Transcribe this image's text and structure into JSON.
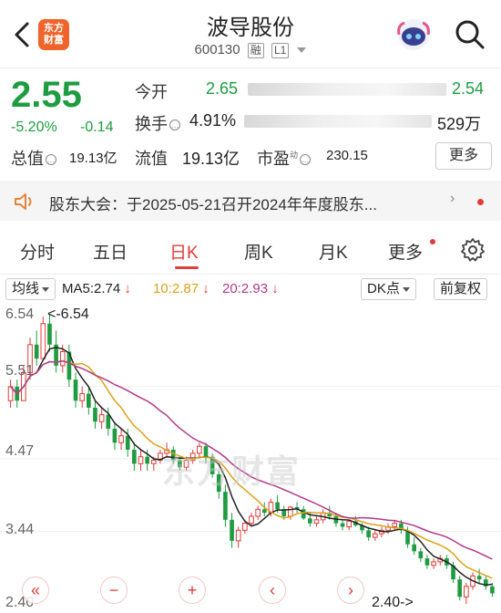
{
  "header": {
    "logo_line1": "东方",
    "logo_line2": "财富",
    "stock_name": "波导股份",
    "stock_code": "600130",
    "tag_rong": "融",
    "tag_level": "L1"
  },
  "quote": {
    "price": "2.55",
    "change_pct": "-5.20%",
    "change_abs": "-0.14",
    "open_label": "今开",
    "open_value": "2.65",
    "open_right": "2.54",
    "turnover_label": "换手",
    "turnover_value": "4.91%",
    "volume_value": "529万",
    "total_cap_label": "总值",
    "total_cap_value": "19.13亿",
    "float_cap_label": "流值",
    "float_cap_value": "19.13亿",
    "pe_label": "市盈",
    "pe_sup": "动",
    "pe_value": "230.15",
    "more_label": "更多"
  },
  "notice": {
    "text": "股东大会：于2025-05-21召开2024年年度股东...",
    "arrow": "›"
  },
  "tabs": {
    "items": [
      "分时",
      "五日",
      "日K",
      "周K",
      "月K",
      "更多"
    ],
    "active": "日K"
  },
  "ma": {
    "selector": "均线",
    "ma5": "MA5:2.74",
    "ma10": "10:2.87",
    "ma20": "20:2.93",
    "dk_label": "DK点",
    "adjust_label": "前复权",
    "colors": {
      "ma5": "#222222",
      "ma10": "#d8a21c",
      "ma20": "#b23a8a"
    }
  },
  "chart_data": {
    "type": "candlestick",
    "y_ticks": [
      "6.54",
      "5.51",
      "4.47",
      "3.44",
      "2.40"
    ],
    "ylim": [
      2.4,
      6.54
    ],
    "high_annotation": "<-6.54",
    "low_annotation": "2.40->",
    "watermark": "东方财富",
    "colors": {
      "up": "#e23b3b",
      "down": "#1f9c42"
    },
    "candles": [
      [
        5.3,
        5.6,
        5.2,
        5.5
      ],
      [
        5.5,
        5.6,
        5.2,
        5.3
      ],
      [
        5.3,
        5.8,
        5.3,
        5.7
      ],
      [
        5.7,
        6.2,
        5.6,
        6.1
      ],
      [
        6.1,
        6.3,
        5.8,
        5.9
      ],
      [
        5.9,
        6.5,
        5.9,
        6.4
      ],
      [
        6.4,
        6.54,
        6.0,
        6.1
      ],
      [
        6.1,
        6.3,
        5.7,
        5.8
      ],
      [
        5.8,
        6.1,
        5.7,
        6.0
      ],
      [
        6.0,
        6.1,
        5.5,
        5.6
      ],
      [
        5.6,
        5.7,
        5.2,
        5.3
      ],
      [
        5.3,
        5.5,
        5.2,
        5.4
      ],
      [
        5.4,
        5.5,
        5.1,
        5.2
      ],
      [
        5.2,
        5.3,
        4.9,
        5.0
      ],
      [
        5.0,
        5.2,
        4.9,
        5.1
      ],
      [
        5.1,
        5.2,
        4.8,
        4.9
      ],
      [
        4.9,
        5.0,
        4.6,
        4.7
      ],
      [
        4.7,
        4.9,
        4.6,
        4.8
      ],
      [
        4.8,
        4.9,
        4.5,
        4.6
      ],
      [
        4.6,
        4.7,
        4.3,
        4.4
      ],
      [
        4.4,
        4.6,
        4.3,
        4.5
      ],
      [
        4.5,
        4.6,
        4.3,
        4.4
      ],
      [
        4.4,
        4.5,
        4.3,
        4.45
      ],
      [
        4.45,
        4.6,
        4.4,
        4.55
      ],
      [
        4.55,
        4.7,
        4.5,
        4.6
      ],
      [
        4.6,
        4.65,
        4.4,
        4.45
      ],
      [
        4.45,
        4.5,
        4.3,
        4.35
      ],
      [
        4.35,
        4.5,
        4.3,
        4.45
      ],
      [
        4.45,
        4.6,
        4.4,
        4.55
      ],
      [
        4.55,
        4.7,
        4.5,
        4.65
      ],
      [
        4.65,
        4.7,
        4.4,
        4.5
      ],
      [
        4.5,
        4.55,
        4.2,
        4.25
      ],
      [
        4.25,
        4.3,
        3.9,
        4.0
      ],
      [
        4.0,
        4.1,
        3.5,
        3.6
      ],
      [
        3.6,
        3.7,
        3.2,
        3.3
      ],
      [
        3.3,
        3.5,
        3.2,
        3.45
      ],
      [
        3.45,
        3.6,
        3.4,
        3.55
      ],
      [
        3.55,
        3.7,
        3.5,
        3.65
      ],
      [
        3.65,
        3.8,
        3.6,
        3.75
      ],
      [
        3.75,
        3.85,
        3.65,
        3.7
      ],
      [
        3.7,
        3.9,
        3.65,
        3.85
      ],
      [
        3.85,
        3.95,
        3.7,
        3.75
      ],
      [
        3.75,
        3.8,
        3.6,
        3.65
      ],
      [
        3.65,
        3.8,
        3.6,
        3.78
      ],
      [
        3.78,
        3.85,
        3.7,
        3.75
      ],
      [
        3.75,
        3.8,
        3.6,
        3.62
      ],
      [
        3.62,
        3.7,
        3.5,
        3.55
      ],
      [
        3.55,
        3.65,
        3.5,
        3.6
      ],
      [
        3.6,
        3.75,
        3.55,
        3.7
      ],
      [
        3.7,
        3.8,
        3.6,
        3.65
      ],
      [
        3.65,
        3.7,
        3.5,
        3.55
      ],
      [
        3.55,
        3.6,
        3.45,
        3.5
      ],
      [
        3.5,
        3.6,
        3.45,
        3.58
      ],
      [
        3.58,
        3.65,
        3.5,
        3.52
      ],
      [
        3.52,
        3.55,
        3.4,
        3.45
      ],
      [
        3.45,
        3.5,
        3.3,
        3.35
      ],
      [
        3.35,
        3.45,
        3.3,
        3.4
      ],
      [
        3.4,
        3.5,
        3.35,
        3.45
      ],
      [
        3.45,
        3.55,
        3.4,
        3.5
      ],
      [
        3.5,
        3.6,
        3.45,
        3.55
      ],
      [
        3.55,
        3.6,
        3.4,
        3.45
      ],
      [
        3.45,
        3.5,
        3.2,
        3.25
      ],
      [
        3.25,
        3.35,
        3.1,
        3.15
      ],
      [
        3.15,
        3.2,
        3.0,
        3.05
      ],
      [
        3.05,
        3.1,
        2.9,
        2.95
      ],
      [
        2.95,
        3.05,
        2.9,
        3.0
      ],
      [
        3.0,
        3.1,
        2.95,
        3.05
      ],
      [
        3.05,
        3.1,
        2.9,
        2.95
      ],
      [
        2.95,
        3.0,
        2.7,
        2.75
      ],
      [
        2.75,
        2.8,
        2.45,
        2.5
      ],
      [
        2.5,
        2.7,
        2.4,
        2.65
      ],
      [
        2.65,
        2.85,
        2.6,
        2.8
      ],
      [
        2.8,
        2.9,
        2.7,
        2.75
      ],
      [
        2.75,
        2.8,
        2.6,
        2.65
      ],
      [
        2.65,
        2.7,
        2.5,
        2.55
      ]
    ]
  },
  "nav": {
    "buttons": [
      "«",
      "−",
      "+",
      "‹",
      "›"
    ]
  }
}
